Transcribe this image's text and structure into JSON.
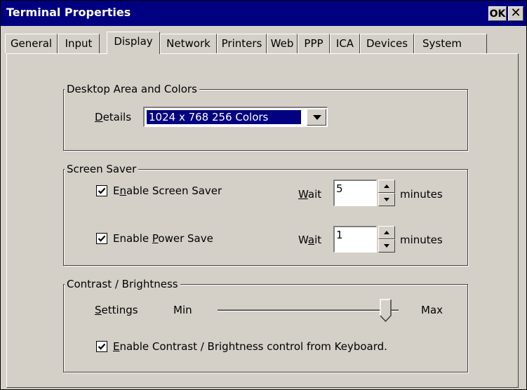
{
  "window": {
    "title": "Terminal Properties",
    "ok_label": "OK",
    "close_glyph": "✕"
  },
  "tabs": [
    {
      "label": "General"
    },
    {
      "label": "Input"
    },
    {
      "label": "Display"
    },
    {
      "label": "Network"
    },
    {
      "label": "Printers"
    },
    {
      "label": "Web"
    },
    {
      "label": "PPP"
    },
    {
      "label": "ICA"
    },
    {
      "label": "Devices"
    },
    {
      "label": "System"
    }
  ],
  "active_tab": "Display",
  "desktop": {
    "title": "Desktop Area and Colors",
    "details_label_u": "D",
    "details_label_rest": "etails",
    "details_value": "1024 x 768 256 Colors"
  },
  "screensaver": {
    "title": "Screen Saver",
    "enable_pre": "E",
    "enable_u": "n",
    "enable_post": "able Screen Saver",
    "enable_checked": true,
    "wait1_u": "W",
    "wait1_rest": "ait",
    "wait1_value": "5",
    "units1": "minutes",
    "power_pre": "Enable ",
    "power_u": "P",
    "power_post": "ower Save",
    "power_checked": true,
    "wait2_pre": "W",
    "wait2_u": "a",
    "wait2_post": "it",
    "wait2_value": "1",
    "units2": "minutes"
  },
  "contrast": {
    "title": "Contrast / Brightness",
    "settings_u": "S",
    "settings_rest": "ettings",
    "min_label": "Min",
    "max_label": "Max",
    "level": 0.93,
    "kb_u": "E",
    "kb_rest": "nable Contrast / Brightness control from Keyboard.",
    "kb_checked": true
  },
  "colors": {
    "titlebar": "#000080",
    "face": "#d4d0c8",
    "selection": "#000080"
  }
}
